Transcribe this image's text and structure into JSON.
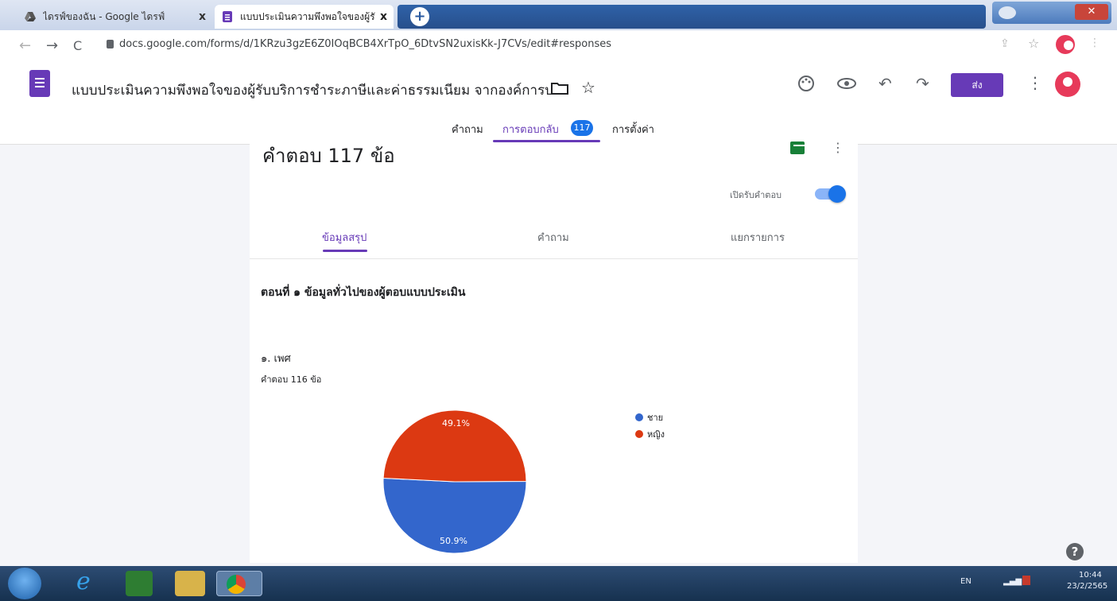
{
  "browser": {
    "tabs": [
      {
        "label": "ไดรฟ์ของฉัน - Google ไดรฟ์",
        "close": "x"
      },
      {
        "label": "แบบประเมินความพึงพอใจของผู้รับ",
        "close": "x"
      }
    ],
    "new_tab": "+",
    "url": "docs.google.com/forms/d/1KRzu3gzE6Z0IOqBCB4XrTpO_6DtvSN2uxisKk-J7CVs/edit#responses",
    "back": "←",
    "forward": "→",
    "reload": "C"
  },
  "form": {
    "title": "แบบประเมินความพึงพอใจของผู้รับบริการชำระภาษีและค่าธรรมเนียม จากองค์การบ",
    "send_label": "ส่ง",
    "tabs": [
      {
        "label": "คำถาม"
      },
      {
        "label": "การตอบกลับ",
        "badge": "117"
      },
      {
        "label": "การตั้งค่า"
      }
    ]
  },
  "responses": {
    "title": "คำตอบ 117 ข้อ",
    "accept_label": "เปิดรับคำตอบ",
    "accept_on": true,
    "sub_tabs": [
      "ข้อมูลสรุป",
      "คำถาม",
      "แยกรายการ"
    ]
  },
  "section": {
    "title": "ตอนที่ ๑ ข้อมูลทั่วไปของผู้ตอบแบบประเมิน"
  },
  "question": {
    "title": "๑. เพศ",
    "count": "คำตอบ 116 ข้อ"
  },
  "chart_data": {
    "type": "pie",
    "categories": [
      "ชาย",
      "หญิง"
    ],
    "values": [
      50.9,
      49.1
    ],
    "labels": [
      "50.9%",
      "49.1%"
    ],
    "colors": [
      "#3366cc",
      "#dc3912"
    ],
    "legend": "right"
  },
  "taskbar": {
    "lang": "EN",
    "time": "10:44",
    "date": "23/2/2565"
  },
  "colors": {
    "brand": "#673ab7",
    "accent": "#1a73e8"
  }
}
